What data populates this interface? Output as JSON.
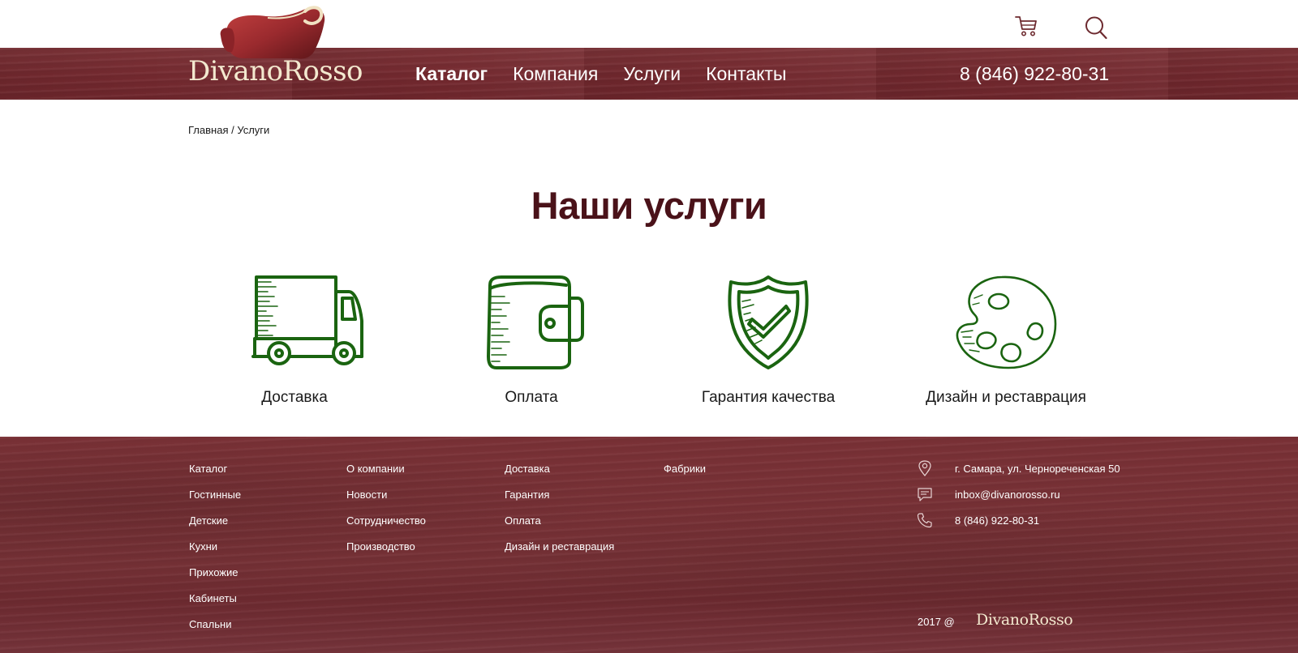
{
  "header": {
    "logo_text": "DivanoRosso",
    "nav": [
      {
        "label": "Каталог",
        "active": true
      },
      {
        "label": "Компания",
        "active": false
      },
      {
        "label": "Услуги",
        "active": false
      },
      {
        "label": "Контакты",
        "active": false
      }
    ],
    "phone": "8 (846) 922-80-31",
    "icons": [
      "cart-icon",
      "search-icon"
    ]
  },
  "breadcrumb": {
    "home": "Главная",
    "separator": " / ",
    "current": "Услуги"
  },
  "main": {
    "title": "Наши услуги",
    "services": [
      {
        "label": "Доставка",
        "icon": "delivery-truck-icon"
      },
      {
        "label": "Оплата",
        "icon": "wallet-icon"
      },
      {
        "label": "Гарантия качества",
        "icon": "quality-shield-icon"
      },
      {
        "label": "Дизайн и реставрация",
        "icon": "palette-icon"
      }
    ]
  },
  "footer": {
    "col_catalog": [
      "Каталог",
      "Гостинные",
      "Детские",
      "Кухни",
      "Прихожие",
      "Кабинеты",
      "Спальни"
    ],
    "col_company": [
      "О компании",
      "Новости",
      "Сотрудничество",
      "Производство"
    ],
    "col_services": [
      "Доставка",
      "Гарантия",
      "Оплата",
      "Дизайн и реставрация"
    ],
    "col_factories": [
      "Фабрики"
    ],
    "contacts": {
      "address": "г. Самара, ул. Чернореченская 50",
      "email": "inbox@divanorosso.ru",
      "phone": "8 (846) 922-80-31"
    },
    "copyright": "2017 @",
    "logo_text": "DivanoRosso"
  },
  "colors": {
    "brand_wood": "#74292f",
    "title": "#4a1219",
    "icon_green": "#1a6410",
    "logo_cream": "#f3e9cf"
  }
}
